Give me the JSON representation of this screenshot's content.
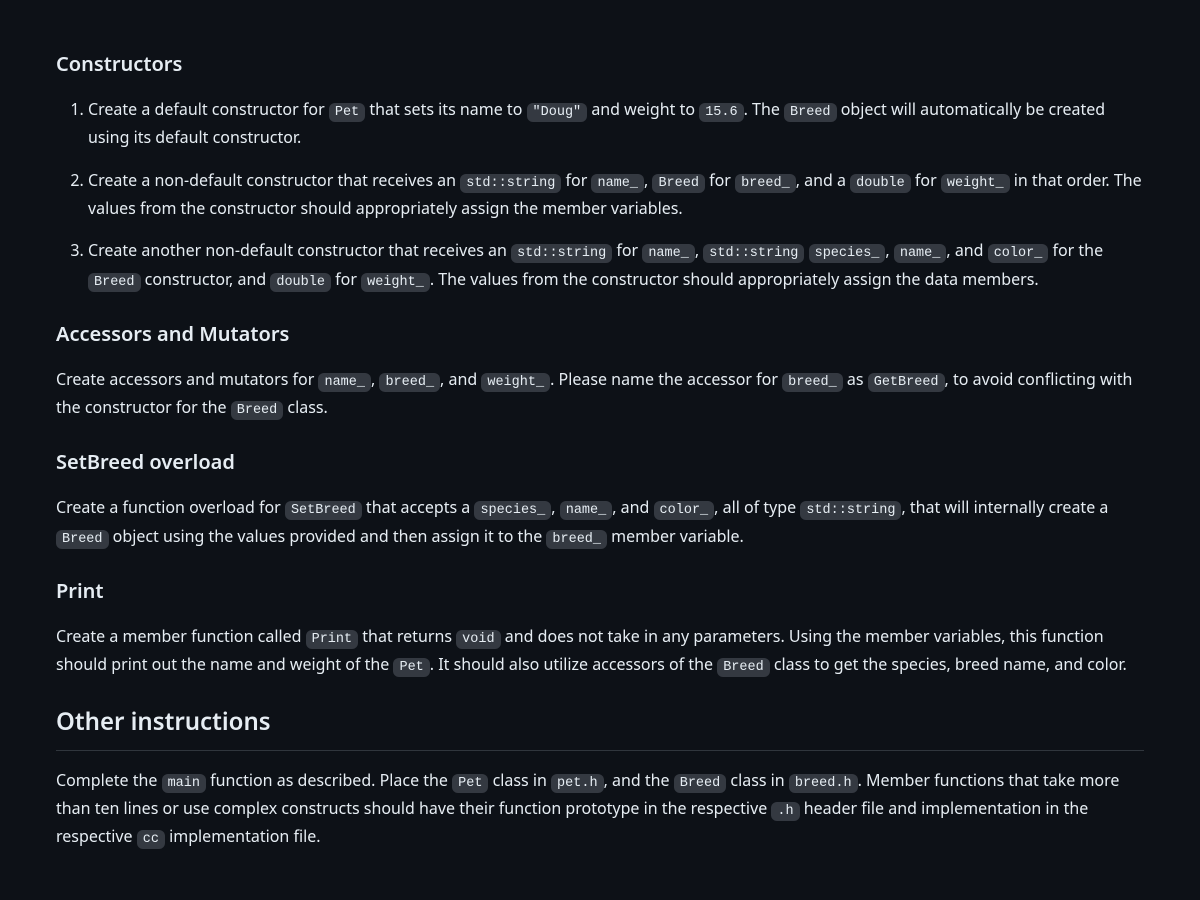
{
  "constructors": {
    "heading": "Constructors",
    "items": [
      {
        "t1": "Create a default constructor for ",
        "c1": "Pet",
        "t2": " that sets its name to ",
        "c2": "\"Doug\"",
        "t3": " and weight to ",
        "c3": "15.6",
        "t4": ". The ",
        "c4": "Breed",
        "t5": " object will automatically be created using its default constructor."
      },
      {
        "t1": "Create a non-default constructor that receives an ",
        "c1": "std::string",
        "t2": " for ",
        "c2": "name_",
        "t3": ", ",
        "c3": "Breed",
        "t4": " for ",
        "c4": "breed_",
        "t5": ", and a ",
        "c5": "double",
        "t6": " for ",
        "c6": "weight_",
        "t7": " in that order. The values from the constructor should appropriately assign the member variables."
      },
      {
        "t1": "Create another non-default constructor that receives an ",
        "c1": "std::string",
        "t2": " for ",
        "c2": "name_",
        "t3": ", ",
        "c3": "std::string",
        "t4": " ",
        "c4": "species_",
        "t5": ", ",
        "c5": "name_",
        "t6": ", and ",
        "c6": "color_",
        "t7": " for the ",
        "c7": "Breed",
        "t8": " constructor, and ",
        "c8": "double",
        "t9": " for ",
        "c9": "weight_",
        "t10": ". The values from the constructor should appropriately assign the data members."
      }
    ]
  },
  "accessors": {
    "heading": "Accessors and Mutators",
    "t1": "Create accessors and mutators for ",
    "c1": "name_",
    "t2": ", ",
    "c2": "breed_",
    "t3": ", and ",
    "c3": "weight_",
    "t4": ". Please name the accessor for ",
    "c4": "breed_",
    "t5": " as ",
    "c5": "GetBreed",
    "t6": ", to avoid conflicting with the constructor for the ",
    "c6": "Breed",
    "t7": " class."
  },
  "setbreed": {
    "heading": "SetBreed overload",
    "t1": "Create a function overload for ",
    "c1": "SetBreed",
    "t2": " that accepts a ",
    "c2": "species_",
    "t3": ", ",
    "c3": "name_",
    "t4": ", and ",
    "c4": "color_",
    "t5": ", all of type ",
    "c5": "std::string",
    "t6": ", that will internally create a ",
    "c6": "Breed",
    "t7": " object using the values provided and then assign it to the ",
    "c7": "breed_",
    "t8": " member variable."
  },
  "print": {
    "heading": "Print",
    "t1": "Create a member function called ",
    "c1": "Print",
    "t2": " that returns ",
    "c2": "void",
    "t3": " and does not take in any parameters. Using the member variables, this function should print out the name and weight of the ",
    "c3": "Pet",
    "t4": ". It should also utilize accessors of the ",
    "c4": "Breed",
    "t5": " class to get the species, breed name, and color."
  },
  "other": {
    "heading": "Other instructions",
    "t1": "Complete the ",
    "c1": "main",
    "t2": " function as described. Place the ",
    "c2": "Pet",
    "t3": " class in ",
    "c3": "pet.h",
    "t4": ", and the ",
    "c4": "Breed",
    "t5": " class in ",
    "c5": "breed.h",
    "t6": ". Member functions that take more than ten lines or use complex constructs should have their function prototype in the respective ",
    "c6": ".h",
    "t7": " header file and implementation in the respective ",
    "c7": "cc",
    "t8": " implementation file."
  }
}
